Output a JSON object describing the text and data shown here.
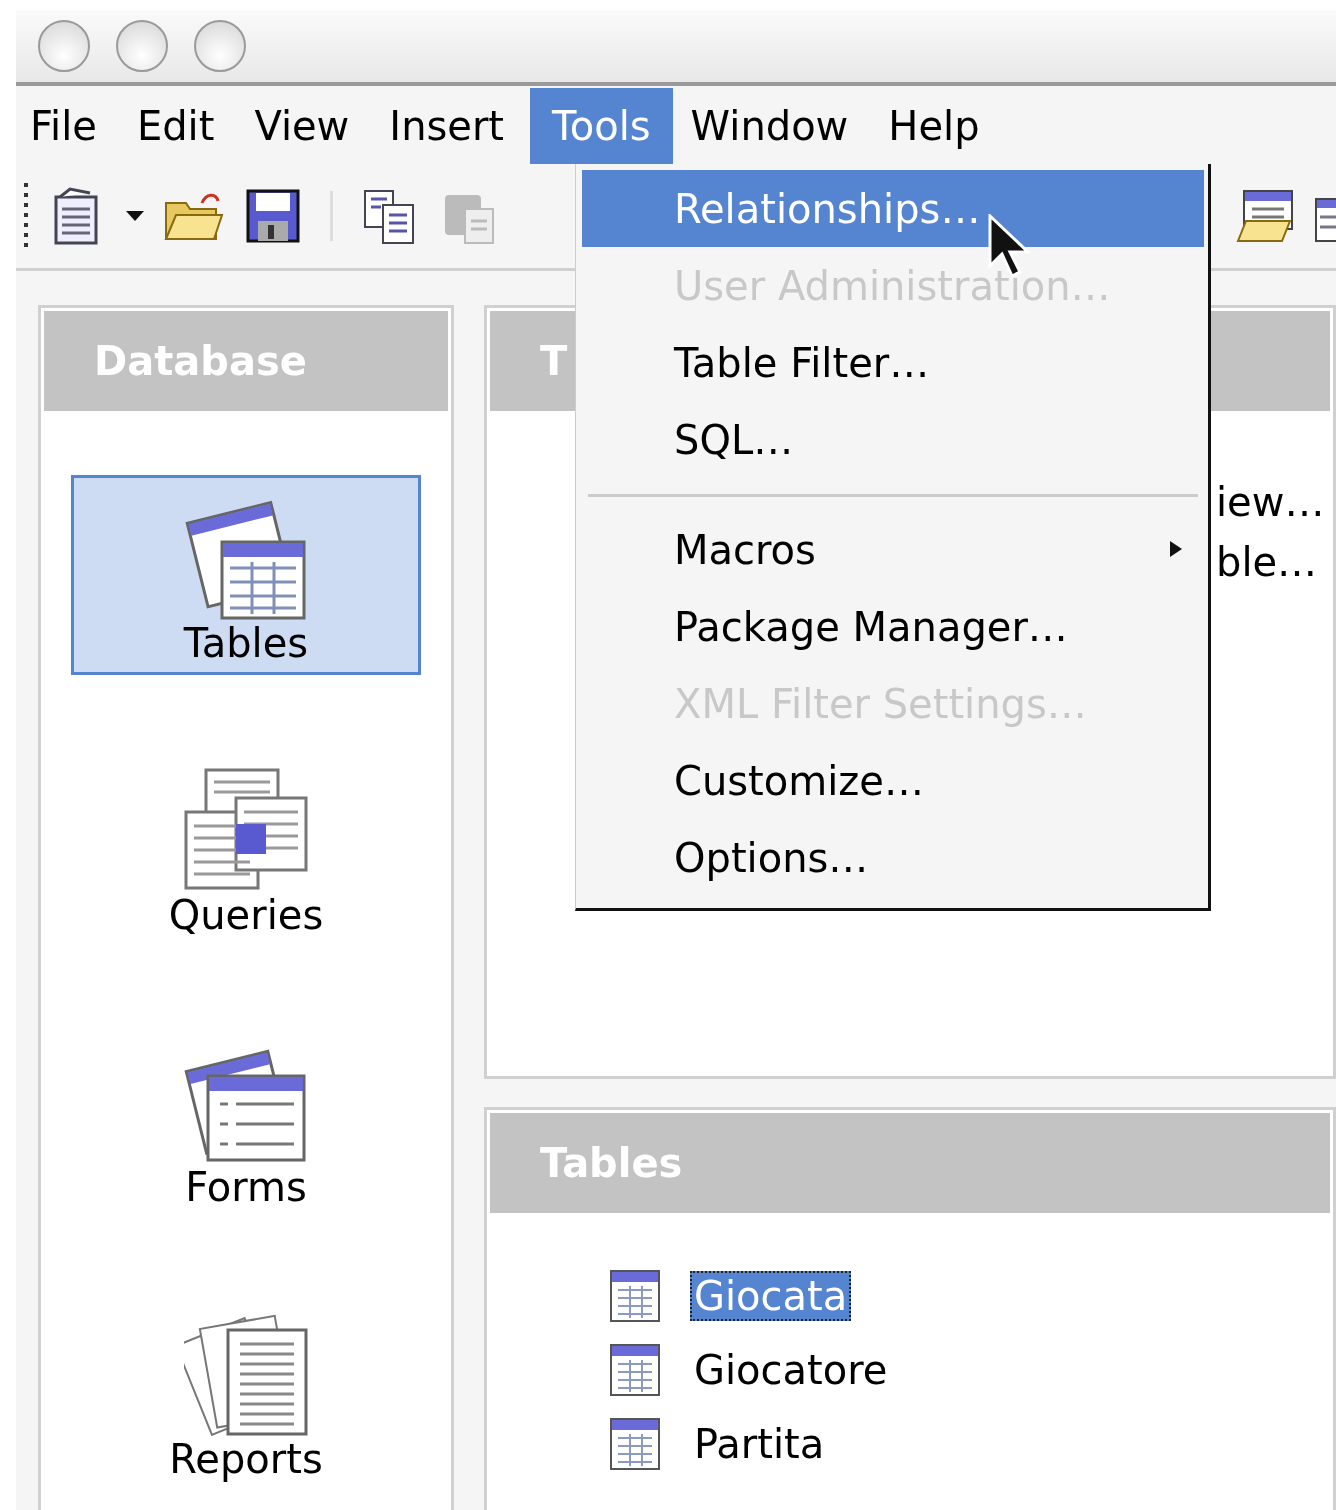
{
  "menu_bar": [
    {
      "label": "File",
      "selected": false
    },
    {
      "label": "Edit",
      "selected": false
    },
    {
      "label": "View",
      "selected": false
    },
    {
      "label": "Insert",
      "selected": false
    },
    {
      "label": "Tools",
      "selected": true
    },
    {
      "label": "Window",
      "selected": false
    },
    {
      "label": "Help",
      "selected": false
    }
  ],
  "tools_menu": {
    "items": [
      {
        "kind": "item",
        "label": "Relationships…",
        "selected": true,
        "disabled": false
      },
      {
        "kind": "item",
        "label": "User Administration…",
        "selected": false,
        "disabled": true
      },
      {
        "kind": "item",
        "label": "Table Filter…",
        "selected": false,
        "disabled": false
      },
      {
        "kind": "item",
        "label": "SQL…",
        "selected": false,
        "disabled": false
      },
      {
        "kind": "separator"
      },
      {
        "kind": "submenu",
        "label": "Macros",
        "selected": false,
        "disabled": false
      },
      {
        "kind": "item",
        "label": "Package Manager…",
        "selected": false,
        "disabled": false
      },
      {
        "kind": "item",
        "label": "XML Filter Settings…",
        "selected": false,
        "disabled": true
      },
      {
        "kind": "item",
        "label": "Customize…",
        "selected": false,
        "disabled": false
      },
      {
        "kind": "item",
        "label": "Options…",
        "selected": false,
        "disabled": false
      }
    ]
  },
  "sidebar": {
    "title": "Database",
    "items": [
      {
        "kind": "tables",
        "label": "Tables",
        "selected": true
      },
      {
        "kind": "queries",
        "label": "Queries",
        "selected": false
      },
      {
        "kind": "forms",
        "label": "Forms",
        "selected": false
      },
      {
        "kind": "reports",
        "label": "Reports",
        "selected": false
      }
    ]
  },
  "tasks": {
    "title": "T",
    "items": [
      "iew…",
      "ble…"
    ]
  },
  "tables_panel": {
    "title": "Tables",
    "items": [
      {
        "label": "Giocata",
        "selected": true
      },
      {
        "label": "Giocatore",
        "selected": false
      },
      {
        "label": "Partita",
        "selected": false
      }
    ]
  }
}
